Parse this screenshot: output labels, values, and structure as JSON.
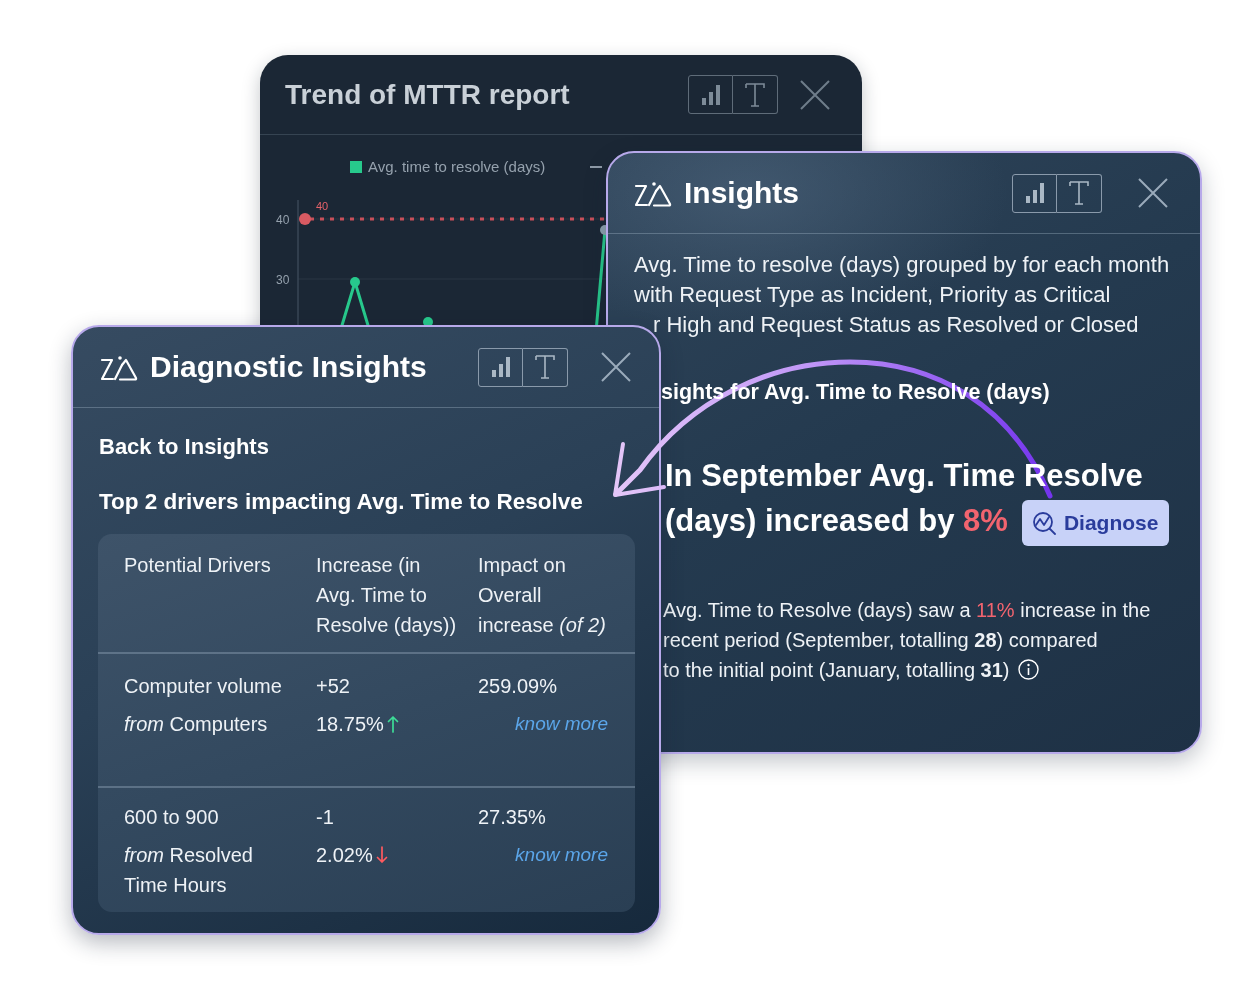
{
  "trend_card": {
    "title": "Trend of MTTR report",
    "legend": [
      "Avg. time to resolve (days)"
    ],
    "y_ticks": [
      "40",
      "30"
    ],
    "point_label": "40"
  },
  "insights_card": {
    "title": "Insights",
    "description": [
      "Avg. Time to resolve (days) grouped by for each month",
      "with Request Type as Incident, Priority as Critical",
      "r High and Request Status as Resolved or Closed"
    ],
    "section_heading": "sights for Avg. Time to Resolve (days)",
    "headline": [
      {
        "kind": "plain",
        "text": "In September Avg. Time Resolve (days) increased by "
      },
      {
        "kind": "highlight",
        "text": "8%"
      }
    ],
    "diagnose_button": "Diagnose",
    "summary": [
      {
        "kind": "plain",
        "text": "Avg. Time to Resolve (days) saw a "
      },
      {
        "kind": "highlight",
        "text": "11%"
      },
      {
        "kind": "plain",
        "text": " increase in the\nrecent period (September, totalling "
      },
      {
        "kind": "bold",
        "text": "28"
      },
      {
        "kind": "plain",
        "text": ") compared\nto the initial point (January, totalling "
      },
      {
        "kind": "bold",
        "text": "31"
      },
      {
        "kind": "plain",
        "text": ")"
      }
    ]
  },
  "diagnostic_card": {
    "title": "Diagnostic Insights",
    "back_link": "Back to Insights",
    "heading": "Top 2 drivers impacting Avg. Time to Resolve",
    "table": {
      "columns": [
        "Potential Drivers",
        "Increase (in\nAvg. Time to\nResolve (days))",
        "Impact on\nOverall\nincrease *(of 2)*"
      ],
      "rows": [
        {
          "driver": "Computer volume",
          "source": "*from* Computers",
          "change": "+52",
          "change_percent": "18.75%",
          "increase": true,
          "impact": "259.09%",
          "link": "know more"
        },
        {
          "driver": "600 to 900",
          "source": "*from* Resolved\nTime Hours",
          "change": "-1",
          "change_percent": "2.02%",
          "increase": false,
          "impact": "27.35%",
          "link": "know more"
        }
      ]
    }
  }
}
